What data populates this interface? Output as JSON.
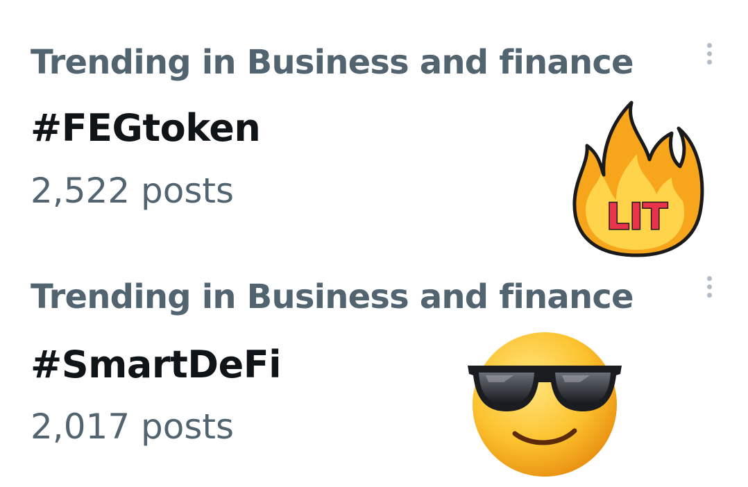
{
  "trends": [
    {
      "context": "Trending in Business and finance",
      "hashtag": "#FEGtoken",
      "count": "2,522 posts",
      "sticker_text": "LIT",
      "sticker": "fire-lit-sticker"
    },
    {
      "context": "Trending in Business and finance",
      "hashtag": "#SmartDeFi",
      "count": "2,017 posts",
      "sticker": "sunglasses-smiley-emoji"
    }
  ],
  "icons": {
    "more": "vertical-ellipsis-icon"
  },
  "colors": {
    "secondary_text": "#536471",
    "primary_text": "#0f1419",
    "more_icon": "#b3bcc4"
  }
}
